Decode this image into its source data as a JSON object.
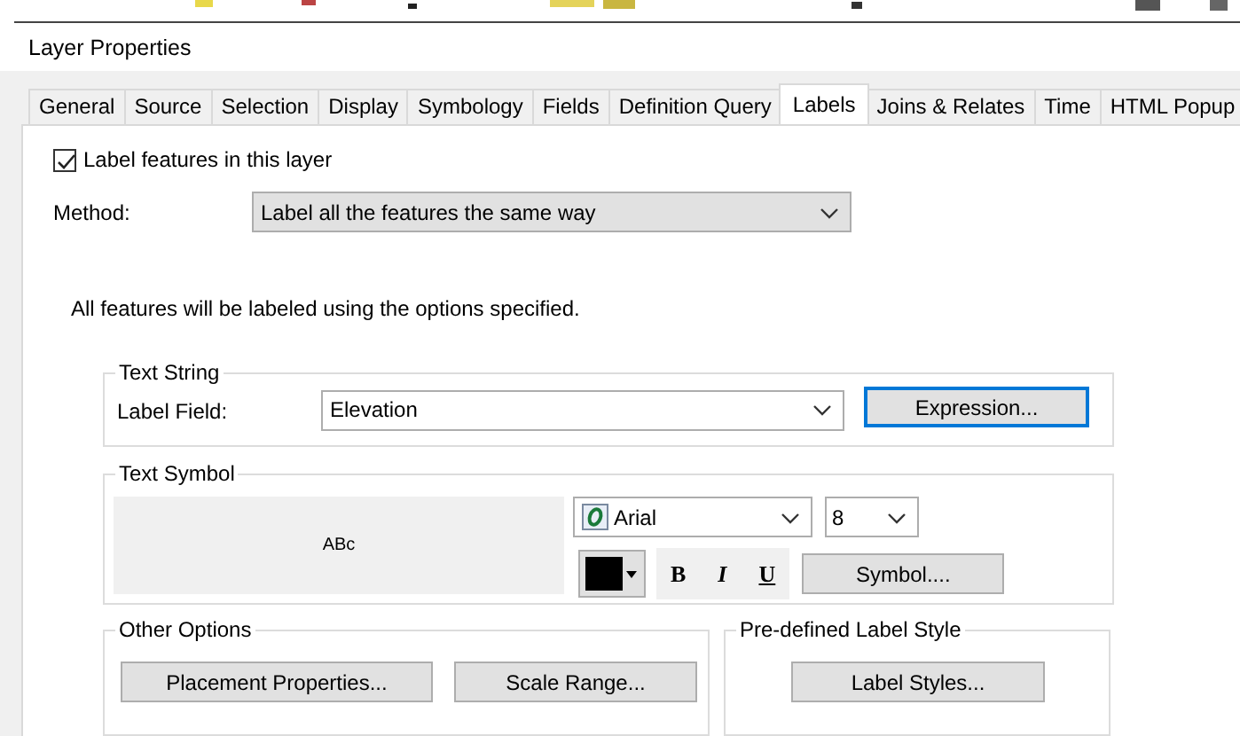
{
  "window": {
    "title": "Layer Properties"
  },
  "tabs": [
    {
      "label": "General",
      "selected": false
    },
    {
      "label": "Source",
      "selected": false
    },
    {
      "label": "Selection",
      "selected": false
    },
    {
      "label": "Display",
      "selected": false
    },
    {
      "label": "Symbology",
      "selected": false
    },
    {
      "label": "Fields",
      "selected": false
    },
    {
      "label": "Definition Query",
      "selected": false
    },
    {
      "label": "Labels",
      "selected": true
    },
    {
      "label": "Joins & Relates",
      "selected": false
    },
    {
      "label": "Time",
      "selected": false
    },
    {
      "label": "HTML Popup",
      "selected": false
    }
  ],
  "label_features": {
    "label": "Label features in this layer",
    "checked": true
  },
  "method": {
    "label": "Method:",
    "value": "Label all the features the same way"
  },
  "description": "All features will be labeled using the options specified.",
  "text_string": {
    "title": "Text String",
    "field_label": "Label Field:",
    "field_value": "Elevation",
    "button": {
      "label": "Expression...",
      "focused": true
    }
  },
  "text_symbol": {
    "title": "Text Symbol",
    "preview": "ABc",
    "font": "Arial",
    "size": "8",
    "bold": "B",
    "italic": "I",
    "underline": "U",
    "button": "Symbol...."
  },
  "other_options": {
    "title": "Other Options",
    "buttons": [
      "Placement Properties...",
      "Scale Range..."
    ]
  },
  "predefined": {
    "title": "Pre-defined Label Style",
    "buttons": [
      "Label Styles..."
    ]
  }
}
